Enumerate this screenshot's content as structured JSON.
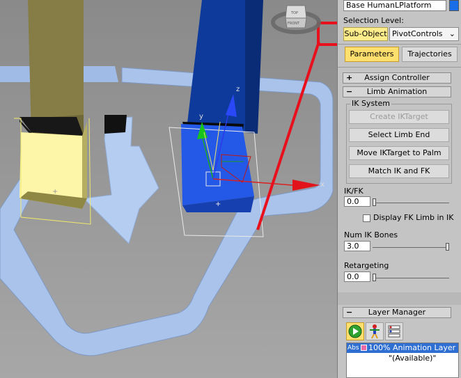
{
  "viewcube": {
    "top_label": "TOP",
    "front_label": "FRONT"
  },
  "axis_labels": {
    "x": "x",
    "y": "y",
    "z": "z"
  },
  "panel": {
    "object_name": "Base HumanLPlatform",
    "selection_level_label": "Selection Level:",
    "selection_level_value": "Sub-Object",
    "selection_dropdown_value": "PivotControls",
    "tabs": [
      {
        "label": "Parameters"
      },
      {
        "label": "Trajectories"
      }
    ],
    "assign_controller": {
      "sign": "+",
      "label": "Assign Controller"
    },
    "limb_animation": {
      "sign": "−",
      "label": "Limb Animation",
      "ik_system_label": "IK System",
      "buttons": [
        "Create IKTarget",
        "Select Limb End",
        "Move IKTarget to Palm",
        "Match IK and FK"
      ],
      "ikfk_label": "IK/FK",
      "ikfk_value": "0.0",
      "ikfk_level": 0.0,
      "display_fk_label": "Display FK Limb in IK",
      "display_fk_checked": false,
      "num_ik_bones_label": "Num IK Bones",
      "num_ik_bones_value": "3.0",
      "num_ik_bones_level": 1.0,
      "retargeting_label": "Retargeting",
      "retargeting_value": "0.0",
      "retargeting_level": 0.0
    },
    "layer_manager": {
      "sign": "−",
      "label": "Layer Manager",
      "layer_row": {
        "abs": "Abs",
        "text": "100% Animation Layer"
      },
      "available_text": "\"(Available)\""
    }
  },
  "colors": {
    "highlight_yellow": "#ffec8a",
    "selection_red": "#e8101c",
    "layer_select_blue": "#2e6fd1"
  }
}
